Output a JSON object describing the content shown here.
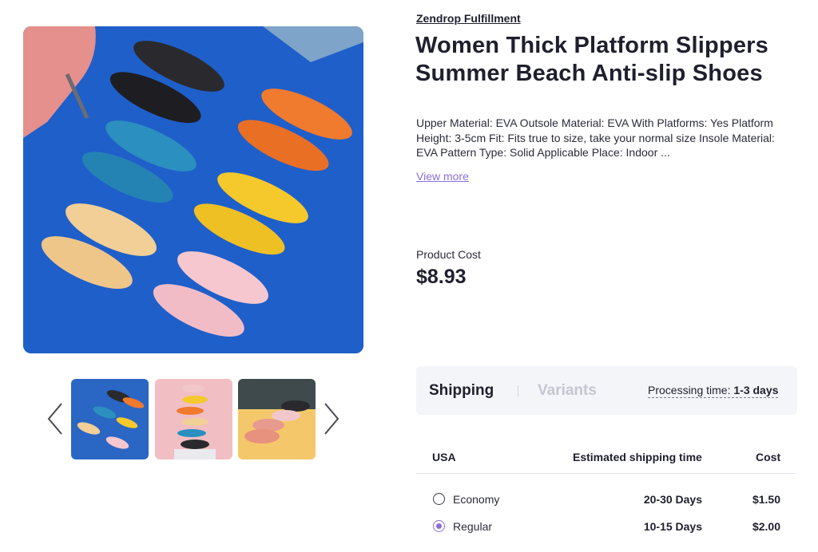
{
  "product": {
    "supplier": "Zendrop Fulfillment",
    "title": "Women Thick Platform Slippers Summer Beach Anti-slip Shoes",
    "description": "Upper Material: EVA Outsole Material: EVA With Platforms: Yes Platform Height: 3-5cm Fit: Fits true to size, take your normal size Insole Material: EVA Pattern Type: Solid Applicable Place: Indoor ...",
    "view_more": "View more",
    "cost_label": "Product Cost",
    "cost_value": "$8.93"
  },
  "gallery": {
    "main_image": "slippers-on-blue-background",
    "thumbnails": [
      "slippers-grid-blue",
      "stacked-slippers-pink",
      "slippers-on-yellow"
    ],
    "selected_index": 0
  },
  "tabs": {
    "items": [
      {
        "label": "Shipping",
        "active": true
      },
      {
        "label": "Variants",
        "active": false
      }
    ],
    "processing_label": "Processing time:",
    "processing_value": "1-3 days"
  },
  "shipping": {
    "headers": {
      "country": "USA",
      "time": "Estimated shipping time",
      "cost": "Cost"
    },
    "options": [
      {
        "name": "Economy",
        "time": "20-30 Days",
        "cost": "$1.50",
        "selected": false
      },
      {
        "name": "Regular",
        "time": "10-15 Days",
        "cost": "$2.00",
        "selected": true
      }
    ]
  },
  "colors": {
    "accent": "#8b6fd6",
    "text": "#1f1f2e",
    "tab_panel_bg": "#f4f5f9",
    "image_bg": "#1f5fc9"
  }
}
